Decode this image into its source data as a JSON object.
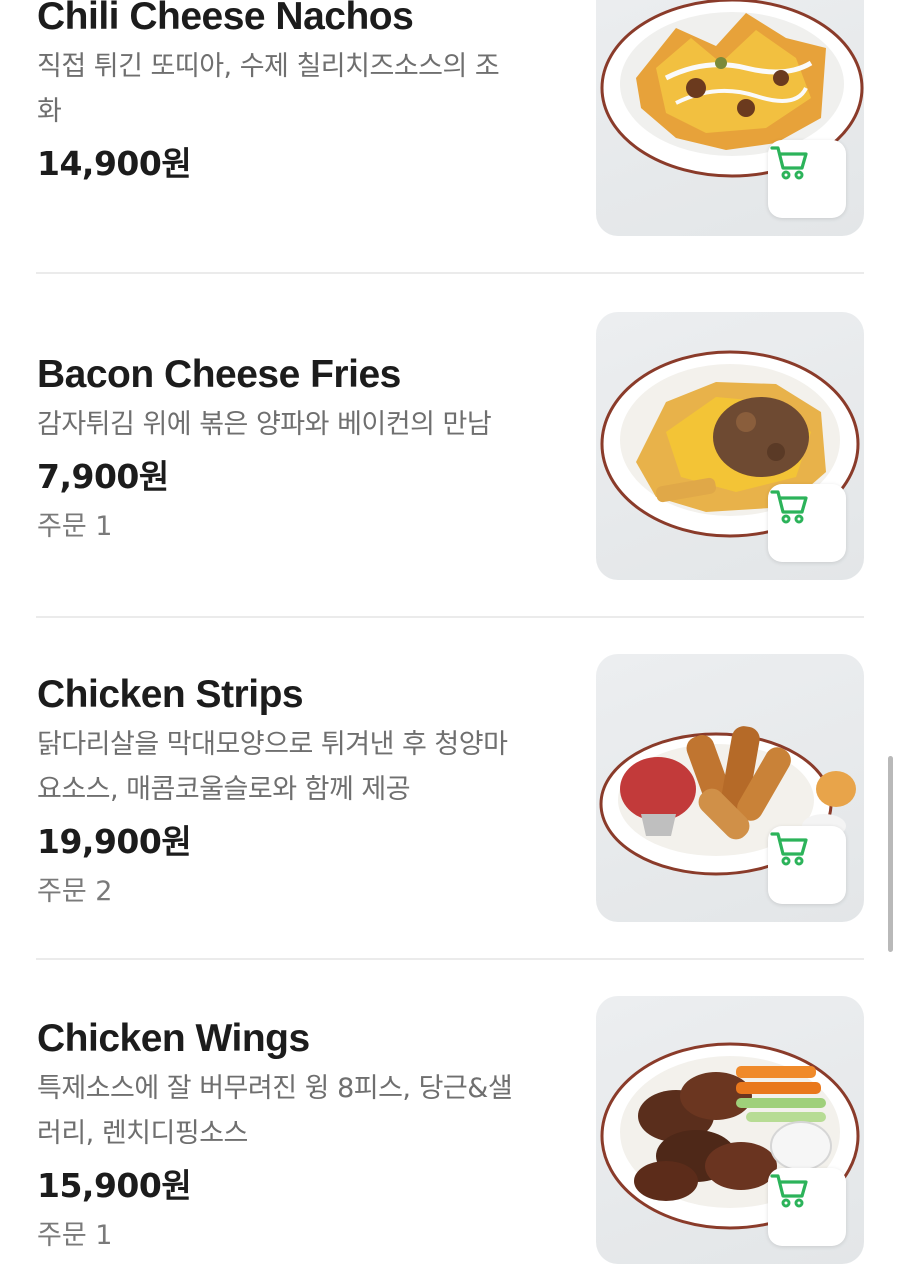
{
  "menu": {
    "items": [
      {
        "name": "Chili Cheese Nachos",
        "description": "직접 튀긴 또띠아, 수제 칠리치즈소스의 조화",
        "description_lines": [
          "직접 튀긴 또띠아, 수제 칠리치즈소스의 조",
          "화"
        ],
        "price": "14,900원",
        "orders": "",
        "image": "nachos-photo",
        "cart_icon": "cart-icon"
      },
      {
        "name": "Bacon Cheese Fries",
        "description": "감자튀김 위에 볶은 양파와 베이컨의 만남",
        "description_lines": [
          "감자튀김 위에 볶은 양파와 베이컨의 만남"
        ],
        "price": "7,900원",
        "orders": "주문 1",
        "image": "fries-photo",
        "cart_icon": "cart-icon"
      },
      {
        "name": "Chicken Strips",
        "description": "닭다리살을 막대모양으로 튀겨낸 후 청양마요소스, 매콤코울슬로와 함께 제공",
        "description_lines": [
          "닭다리살을 막대모양으로 튀겨낸 후 청양마",
          "요소스, 매콤코울슬로와 함께 제공"
        ],
        "price": "19,900원",
        "orders": "주문 2",
        "image": "chicken-strips-photo",
        "cart_icon": "cart-icon"
      },
      {
        "name": "Chicken Wings",
        "description": "특제소스에 잘 버무려진 윙 8피스, 당근&샐러리, 렌치디핑소스",
        "description_lines": [
          "특제소스에 잘 버무려진 윙 8피스, 당근&샐",
          "러리, 렌치디핑소스"
        ],
        "price": "15,900원",
        "orders": "주문 1",
        "image": "chicken-wings-photo",
        "cart_icon": "cart-icon"
      }
    ]
  },
  "colors": {
    "cart_green": "#2cb35a",
    "divider": "#ebebeb",
    "secondary_text": "#6f6f6f"
  }
}
